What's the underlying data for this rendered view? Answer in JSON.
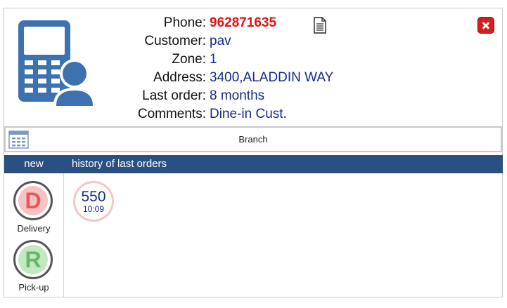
{
  "customer_info": {
    "phone_label": "Phone:",
    "phone_value": "962871635",
    "customer_label": "Customer:",
    "customer_value": "pav",
    "zone_label": "Zone:",
    "zone_value": "1",
    "address_label": "Address:",
    "address_value": "3400,ALADDIN WAY",
    "last_order_label": "Last order:",
    "last_order_value": "8 months",
    "comments_label": "Comments:",
    "comments_value": "Dine-in Cust."
  },
  "icons": {
    "phone_customer": "phone-customer-icon",
    "document": "document-icon",
    "close": "close-icon",
    "branch": "calendar-grid-icon"
  },
  "branch_bar": {
    "label": "Branch"
  },
  "nav": {
    "new_label": "new",
    "history_label": "history of last orders"
  },
  "order_types": [
    {
      "letter": "D",
      "label": "Delivery"
    },
    {
      "letter": "R",
      "label": "Pick-up"
    }
  ],
  "history": [
    {
      "amount": "550",
      "time": "10:09"
    }
  ],
  "colors": {
    "nav_bg": "#2a4f82",
    "phone_value": "#e01414",
    "info_value": "#142a8c",
    "close_button": "#cf1f1f",
    "illustration": "#3d72b0"
  }
}
